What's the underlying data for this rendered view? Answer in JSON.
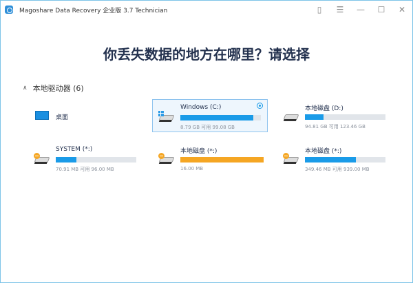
{
  "window": {
    "title": "Magoshare Data Recovery 企业版 3.7 Technician"
  },
  "heading": "你丢失数据的地方在哪里？请选择",
  "section": {
    "label": "本地驱动器 (6)"
  },
  "drives": [
    {
      "name": "桌面",
      "icon": "desktop-icon"
    },
    {
      "name": "Windows (C:)",
      "info": "8.79 GB 可用 99.08 GB",
      "used_fraction": 0.91,
      "color": "#1a9be8",
      "icon": "windows-drive-icon",
      "selected": true
    },
    {
      "name": "本地磁盘 (D:)",
      "info": "94.81 GB 可用 123.46 GB",
      "used_fraction": 0.23,
      "color": "#1a9be8",
      "icon": "hard-drive-icon"
    },
    {
      "name": "SYSTEM (*:)",
      "info": "70.91 MB 可用 96.00 MB",
      "used_fraction": 0.26,
      "color": "#1a9be8",
      "icon": "warning-drive-icon"
    },
    {
      "name": "本地磁盘 (*:)",
      "info": "16.00 MB",
      "used_fraction": 1.0,
      "color": "#f5a623",
      "icon": "warning-drive-icon"
    },
    {
      "name": "本地磁盘 (*:)",
      "info": "349.46 MB 可用 939.00 MB",
      "used_fraction": 0.63,
      "color": "#1a9be8",
      "icon": "warning-drive-icon"
    }
  ]
}
